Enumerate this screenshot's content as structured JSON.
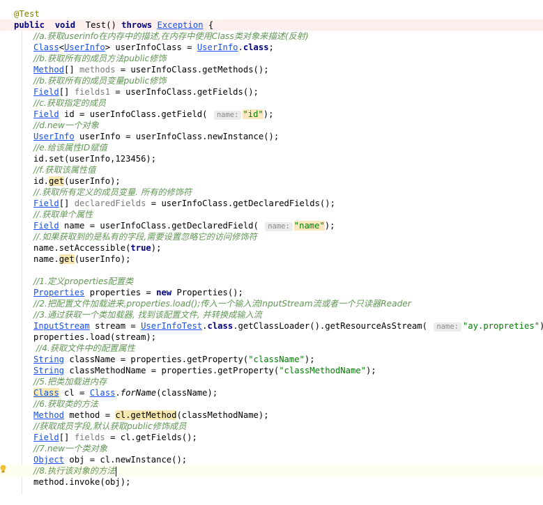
{
  "editor": {
    "lines": [
      {
        "segments": [
          {
            "t": "@Test",
            "c": "ann"
          }
        ]
      },
      {
        "segments": [
          {
            "t": "public",
            "c": "kw"
          },
          {
            "t": "  "
          },
          {
            "t": "void",
            "c": "kw"
          },
          {
            "t": "  Test() "
          },
          {
            "t": "throws",
            "c": "kw"
          },
          {
            "t": " "
          },
          {
            "t": "Exception",
            "c": "cls"
          },
          {
            "t": " {"
          }
        ],
        "hl": true
      },
      {
        "indent": true,
        "segments": [
          {
            "t": "//a.获取userinfo在内存中的描述,在内存中使用Class类对象来描述(反射)",
            "c": "cmt"
          }
        ]
      },
      {
        "indent": true,
        "segments": [
          {
            "t": "Class",
            "c": "cls"
          },
          {
            "t": "<"
          },
          {
            "t": "UserInfo",
            "c": "cls"
          },
          {
            "t": "> userInfoClass = "
          },
          {
            "t": "UserInfo",
            "c": "cls"
          },
          {
            "t": "."
          },
          {
            "t": "class",
            "c": "kw"
          },
          {
            "t": ";"
          }
        ]
      },
      {
        "indent": true,
        "segments": [
          {
            "t": "//b.获取所有的成员方法public修饰",
            "c": "cmt"
          }
        ]
      },
      {
        "indent": true,
        "segments": [
          {
            "t": "Method",
            "c": "cls"
          },
          {
            "t": "[] "
          },
          {
            "t": "methods",
            "c": "var"
          },
          {
            "t": " = userInfoClass.getMethods();"
          }
        ]
      },
      {
        "indent": true,
        "segments": [
          {
            "t": "//b.获取所有的成员变量public修饰",
            "c": "cmt"
          }
        ]
      },
      {
        "indent": true,
        "segments": [
          {
            "t": "Field",
            "c": "cls"
          },
          {
            "t": "[] "
          },
          {
            "t": "fields1",
            "c": "var"
          },
          {
            "t": " = userInfoClass.getFields();"
          }
        ]
      },
      {
        "indent": true,
        "segments": [
          {
            "t": "//c.获取指定的成员",
            "c": "cmt"
          }
        ]
      },
      {
        "indent": true,
        "segments": [
          {
            "t": "Field",
            "c": "cls"
          },
          {
            "t": " id = userInfoClass.getField( "
          },
          {
            "t": "name:",
            "c": "hint"
          },
          {
            "t": "\"id\"",
            "c": "str strhl"
          },
          {
            "t": ");"
          }
        ]
      },
      {
        "indent": true,
        "segments": [
          {
            "t": "//d.new一个对象",
            "c": "cmt"
          }
        ]
      },
      {
        "indent": true,
        "segments": [
          {
            "t": "UserInfo",
            "c": "cls"
          },
          {
            "t": " userInfo = userInfoClass.newInstance();"
          }
        ]
      },
      {
        "indent": true,
        "segments": [
          {
            "t": "//e.给该属性ID赋值",
            "c": "cmt"
          }
        ]
      },
      {
        "indent": true,
        "segments": [
          {
            "t": "id.set(userInfo,123456);"
          }
        ]
      },
      {
        "indent": true,
        "segments": [
          {
            "t": "//f.获取该属性值",
            "c": "cmt"
          }
        ]
      },
      {
        "indent": true,
        "segments": [
          {
            "t": "id."
          },
          {
            "t": "get",
            "c": "mark"
          },
          {
            "t": "(userInfo);"
          }
        ]
      },
      {
        "indent": true,
        "segments": [
          {
            "t": "//.获取所有定义的成员变量. 所有的修饰符",
            "c": "cmt"
          }
        ]
      },
      {
        "indent": true,
        "segments": [
          {
            "t": "Field",
            "c": "cls"
          },
          {
            "t": "[] "
          },
          {
            "t": "declaredFields",
            "c": "var"
          },
          {
            "t": " = userInfoClass.getDeclaredFields();"
          }
        ]
      },
      {
        "indent": true,
        "segments": [
          {
            "t": "//.获取单个属性",
            "c": "cmt"
          }
        ]
      },
      {
        "indent": true,
        "segments": [
          {
            "t": "Field",
            "c": "cls"
          },
          {
            "t": " name = userInfoClass.getDeclaredField( "
          },
          {
            "t": "name:",
            "c": "hint"
          },
          {
            "t": "\"name\"",
            "c": "str strhl"
          },
          {
            "t": ");"
          }
        ]
      },
      {
        "indent": true,
        "segments": [
          {
            "t": "//.如果获取到的是私有的字段,需要设置忽略它的访问修饰符",
            "c": "cmt"
          }
        ]
      },
      {
        "indent": true,
        "segments": [
          {
            "t": "name.setAccessible("
          },
          {
            "t": "true",
            "c": "kw"
          },
          {
            "t": ");"
          }
        ]
      },
      {
        "indent": true,
        "segments": [
          {
            "t": "name."
          },
          {
            "t": "get",
            "c": "mark"
          },
          {
            "t": "(userInfo);"
          }
        ]
      },
      {
        "indent": true,
        "segments": []
      },
      {
        "indent": true,
        "segments": [
          {
            "t": "//1.定义properties配置类",
            "c": "cmt"
          }
        ]
      },
      {
        "indent": true,
        "segments": [
          {
            "t": "Properties",
            "c": "cls"
          },
          {
            "t": " properties = "
          },
          {
            "t": "new",
            "c": "kw"
          },
          {
            "t": " Properties();"
          }
        ]
      },
      {
        "indent": true,
        "segments": [
          {
            "t": "//2.把配置文件加载进来,properties.load();传入一个输入流InputStream流或者一个只读器Reader",
            "c": "cmt"
          }
        ]
      },
      {
        "indent": true,
        "segments": [
          {
            "t": "//3.通过获取一个类加载器, 找到该配置文件, 并转换成输入流",
            "c": "cmt"
          }
        ]
      },
      {
        "indent": true,
        "segments": [
          {
            "t": "InputStream",
            "c": "cls"
          },
          {
            "t": " stream = "
          },
          {
            "t": "UserInfoTest",
            "c": "cls"
          },
          {
            "t": "."
          },
          {
            "t": "class",
            "c": "kw"
          },
          {
            "t": ".getClassLoader().getResourceAsStream( "
          },
          {
            "t": "name:",
            "c": "hint"
          },
          {
            "t": "\"ay.propreties\"",
            "c": "str"
          },
          {
            "t": ");"
          }
        ]
      },
      {
        "indent": true,
        "segments": [
          {
            "t": "properties.load(stream);"
          }
        ]
      },
      {
        "indent": true,
        "segments": [
          {
            "t": " //4.获取文件中的配置属性",
            "c": "cmt"
          }
        ]
      },
      {
        "indent": true,
        "segments": [
          {
            "t": "String",
            "c": "cls"
          },
          {
            "t": " className = properties.getProperty("
          },
          {
            "t": "\"className\"",
            "c": "str"
          },
          {
            "t": ");"
          }
        ]
      },
      {
        "indent": true,
        "segments": [
          {
            "t": "String",
            "c": "cls"
          },
          {
            "t": " classMethodName = properties.getProperty("
          },
          {
            "t": "\"classMethodName\"",
            "c": "str"
          },
          {
            "t": ");"
          }
        ]
      },
      {
        "indent": true,
        "segments": [
          {
            "t": "//5.把类加载进内存",
            "c": "cmt"
          }
        ]
      },
      {
        "indent": true,
        "segments": [
          {
            "t": "Class",
            "c": "cls mark"
          },
          {
            "t": " cl = "
          },
          {
            "t": "Class",
            "c": "cls"
          },
          {
            "t": "."
          },
          {
            "t": "forName",
            "c": "stat"
          },
          {
            "t": "(className);"
          }
        ]
      },
      {
        "indent": true,
        "segments": [
          {
            "t": "//6.获取类的方法",
            "c": "cmt"
          }
        ]
      },
      {
        "indent": true,
        "segments": [
          {
            "t": "Method",
            "c": "cls"
          },
          {
            "t": " method = "
          },
          {
            "t": "cl.getMethod",
            "c": "mark"
          },
          {
            "t": "(classMethodName);"
          }
        ]
      },
      {
        "indent": true,
        "segments": [
          {
            "t": "//获取成员字段,默认获取public修饰成员",
            "c": "cmt"
          }
        ]
      },
      {
        "indent": true,
        "segments": [
          {
            "t": "Field",
            "c": "cls"
          },
          {
            "t": "[] "
          },
          {
            "t": "fields",
            "c": "var"
          },
          {
            "t": " = cl.getFields();"
          }
        ]
      },
      {
        "indent": true,
        "segments": [
          {
            "t": "//7.new一个类对象",
            "c": "cmt"
          }
        ]
      },
      {
        "indent": true,
        "segments": [
          {
            "t": "Object",
            "c": "cls"
          },
          {
            "t": " obj = cl.newInstance();"
          }
        ]
      },
      {
        "indent": true,
        "segments": [
          {
            "t": "//8.执行该对象的方法",
            "c": "cmt"
          }
        ],
        "caret": true
      },
      {
        "indent": true,
        "segments": [
          {
            "t": "method.invoke(obj);"
          }
        ]
      }
    ]
  }
}
